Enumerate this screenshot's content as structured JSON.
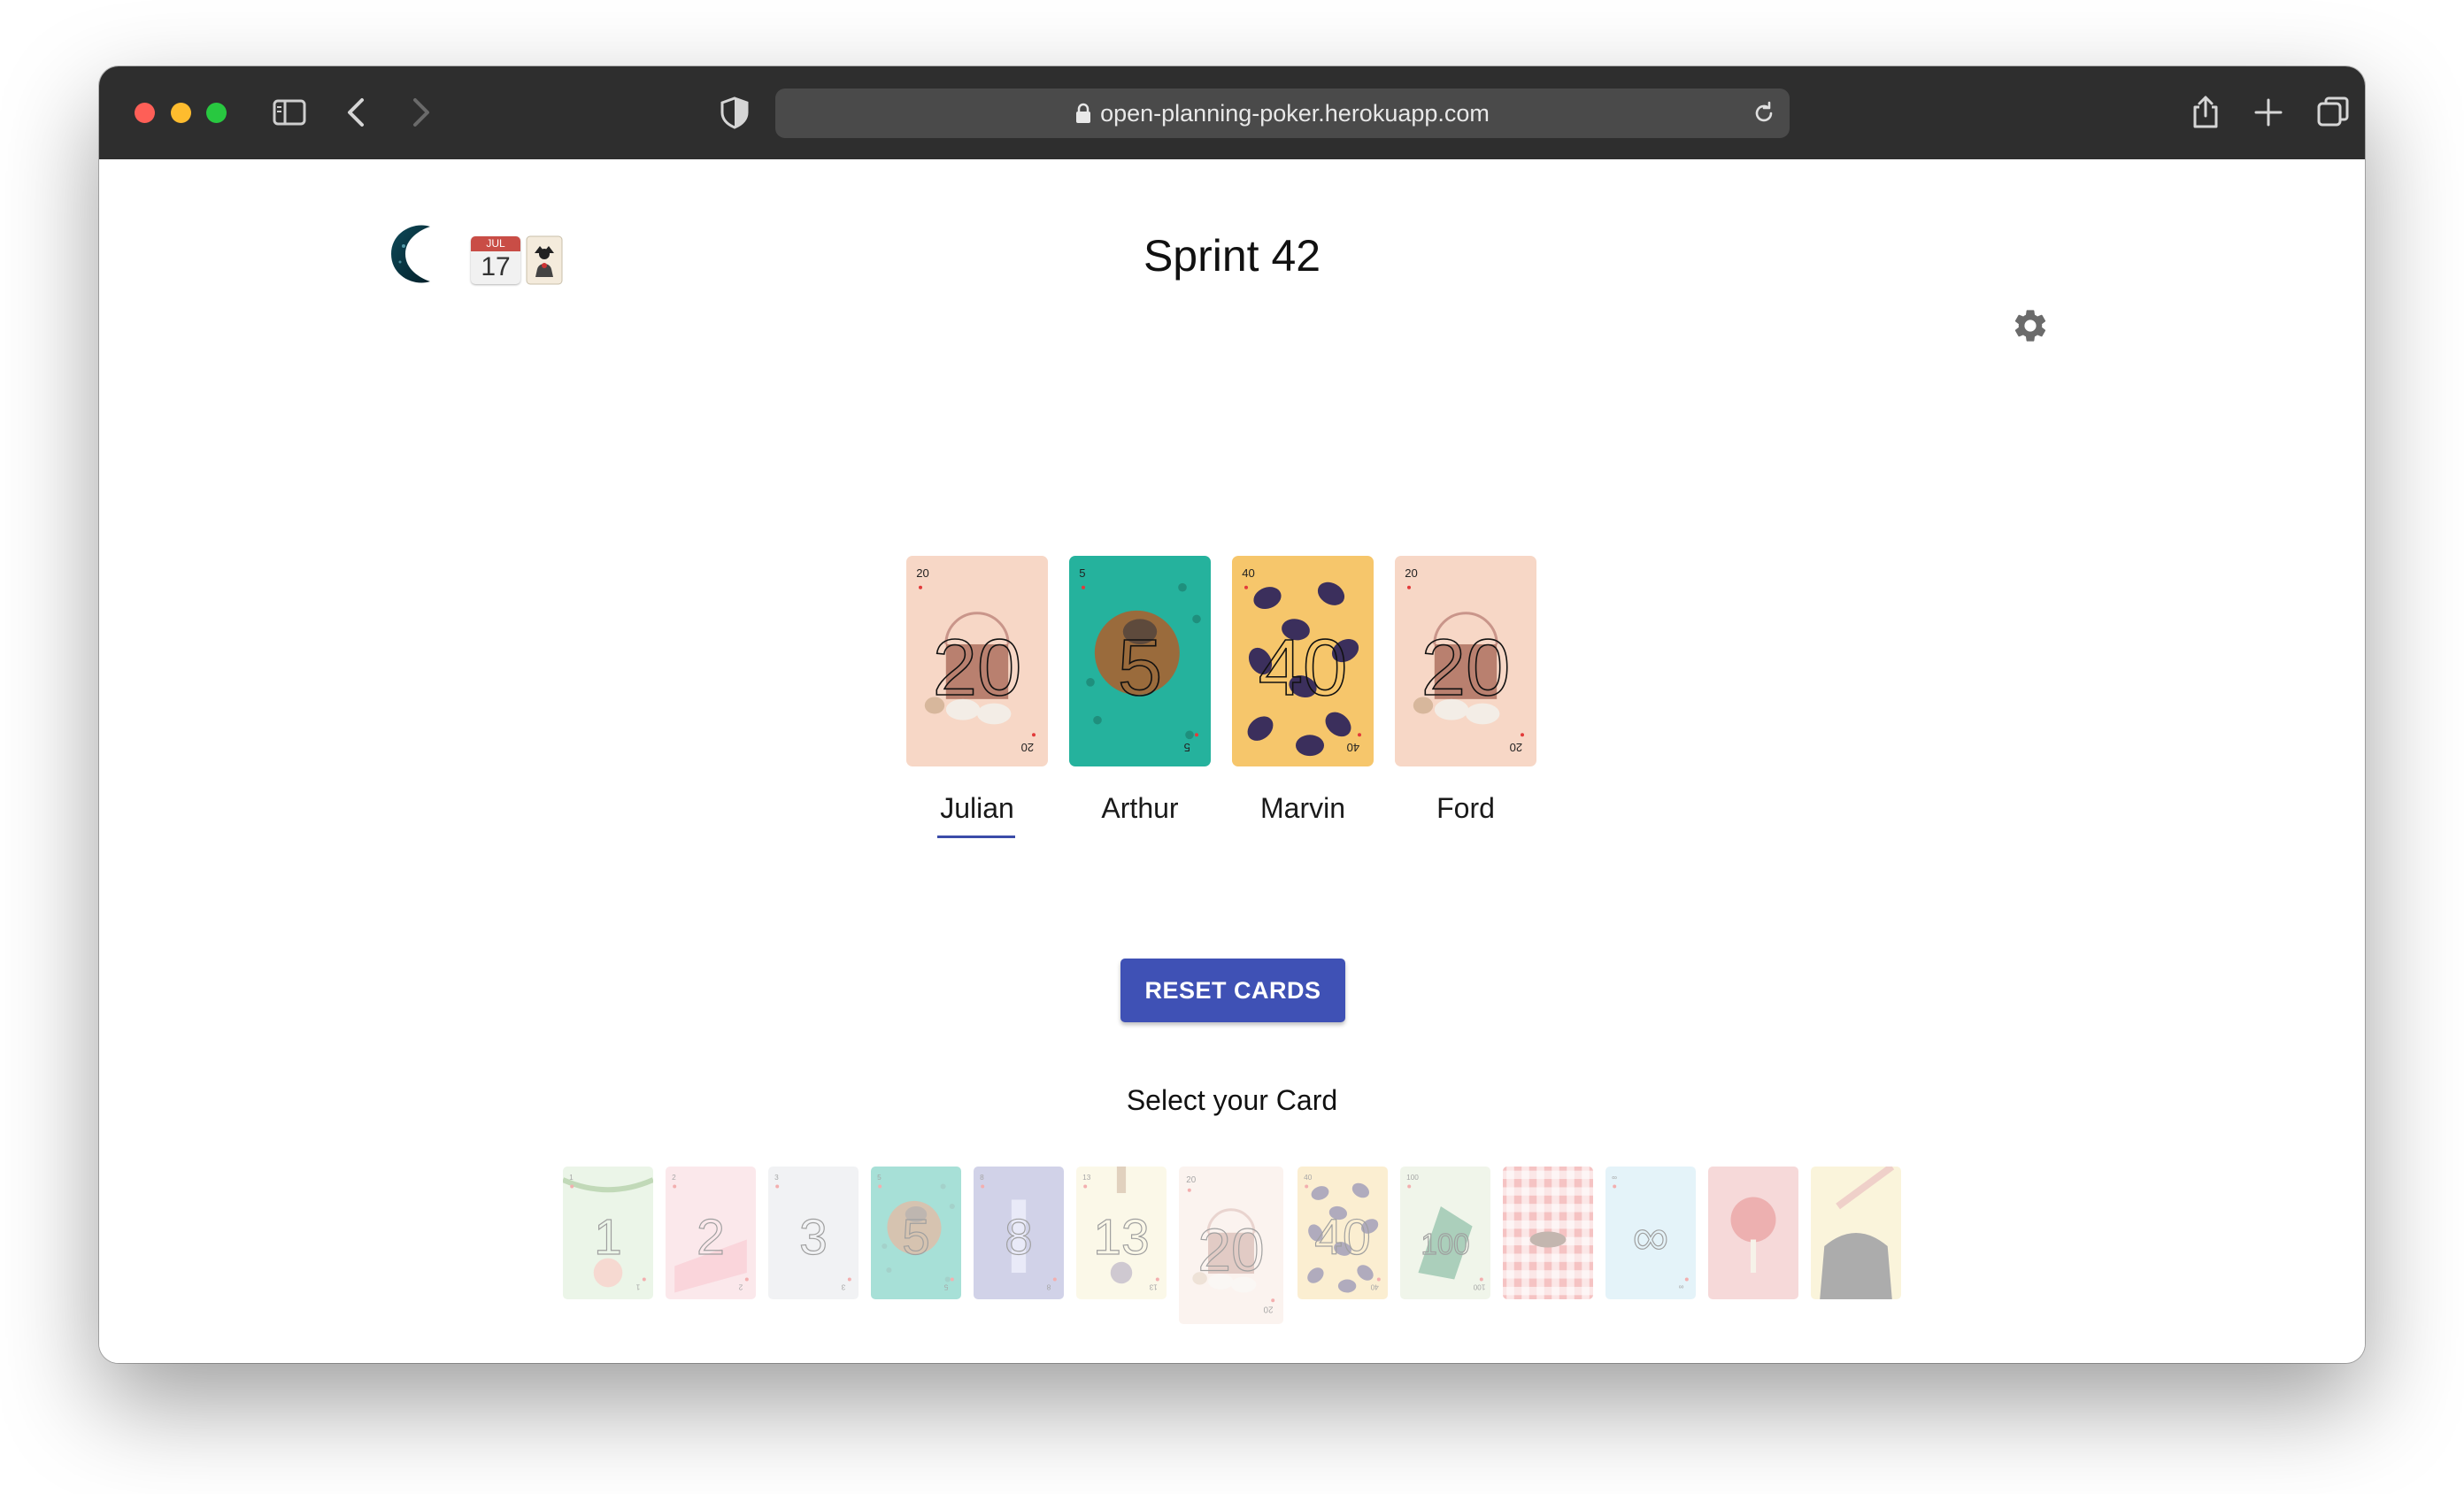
{
  "browser": {
    "url": "open-planning-poker.herokuapp.com"
  },
  "page": {
    "title": "Sprint 42",
    "calendar_month": "JUL",
    "calendar_day": "17",
    "reset_label": "RESET CARDS",
    "select_label": "Select your Card"
  },
  "players": [
    {
      "name": "Julian",
      "card": "20",
      "color": "#f7d7c6",
      "active": true
    },
    {
      "name": "Arthur",
      "card": "5",
      "color": "#25b29d",
      "active": false
    },
    {
      "name": "Marvin",
      "card": "40",
      "color": "#f6c66b",
      "active": false
    },
    {
      "name": "Ford",
      "card": "20",
      "color": "#f7d7c6",
      "active": false
    }
  ],
  "deck": [
    {
      "value": "1",
      "color": "#cfe8c6"
    },
    {
      "value": "2",
      "color": "#f7c6cf"
    },
    {
      "value": "3",
      "color": "#dde1e6"
    },
    {
      "value": "5",
      "color": "#25b29d"
    },
    {
      "value": "8",
      "color": "#8d90c6"
    },
    {
      "value": "13",
      "color": "#f7efc6"
    },
    {
      "value": "20",
      "color": "#f7e2d8"
    },
    {
      "value": "40",
      "color": "#f6d58e"
    },
    {
      "value": "100",
      "color": "#dbe8cb"
    },
    {
      "value": "",
      "color": "#e86b6b"
    },
    {
      "value": "∞",
      "color": "#bde3f2"
    },
    {
      "value": "",
      "color": "#e9a2a2"
    },
    {
      "value": "",
      "color": "#f5e4a8"
    }
  ]
}
